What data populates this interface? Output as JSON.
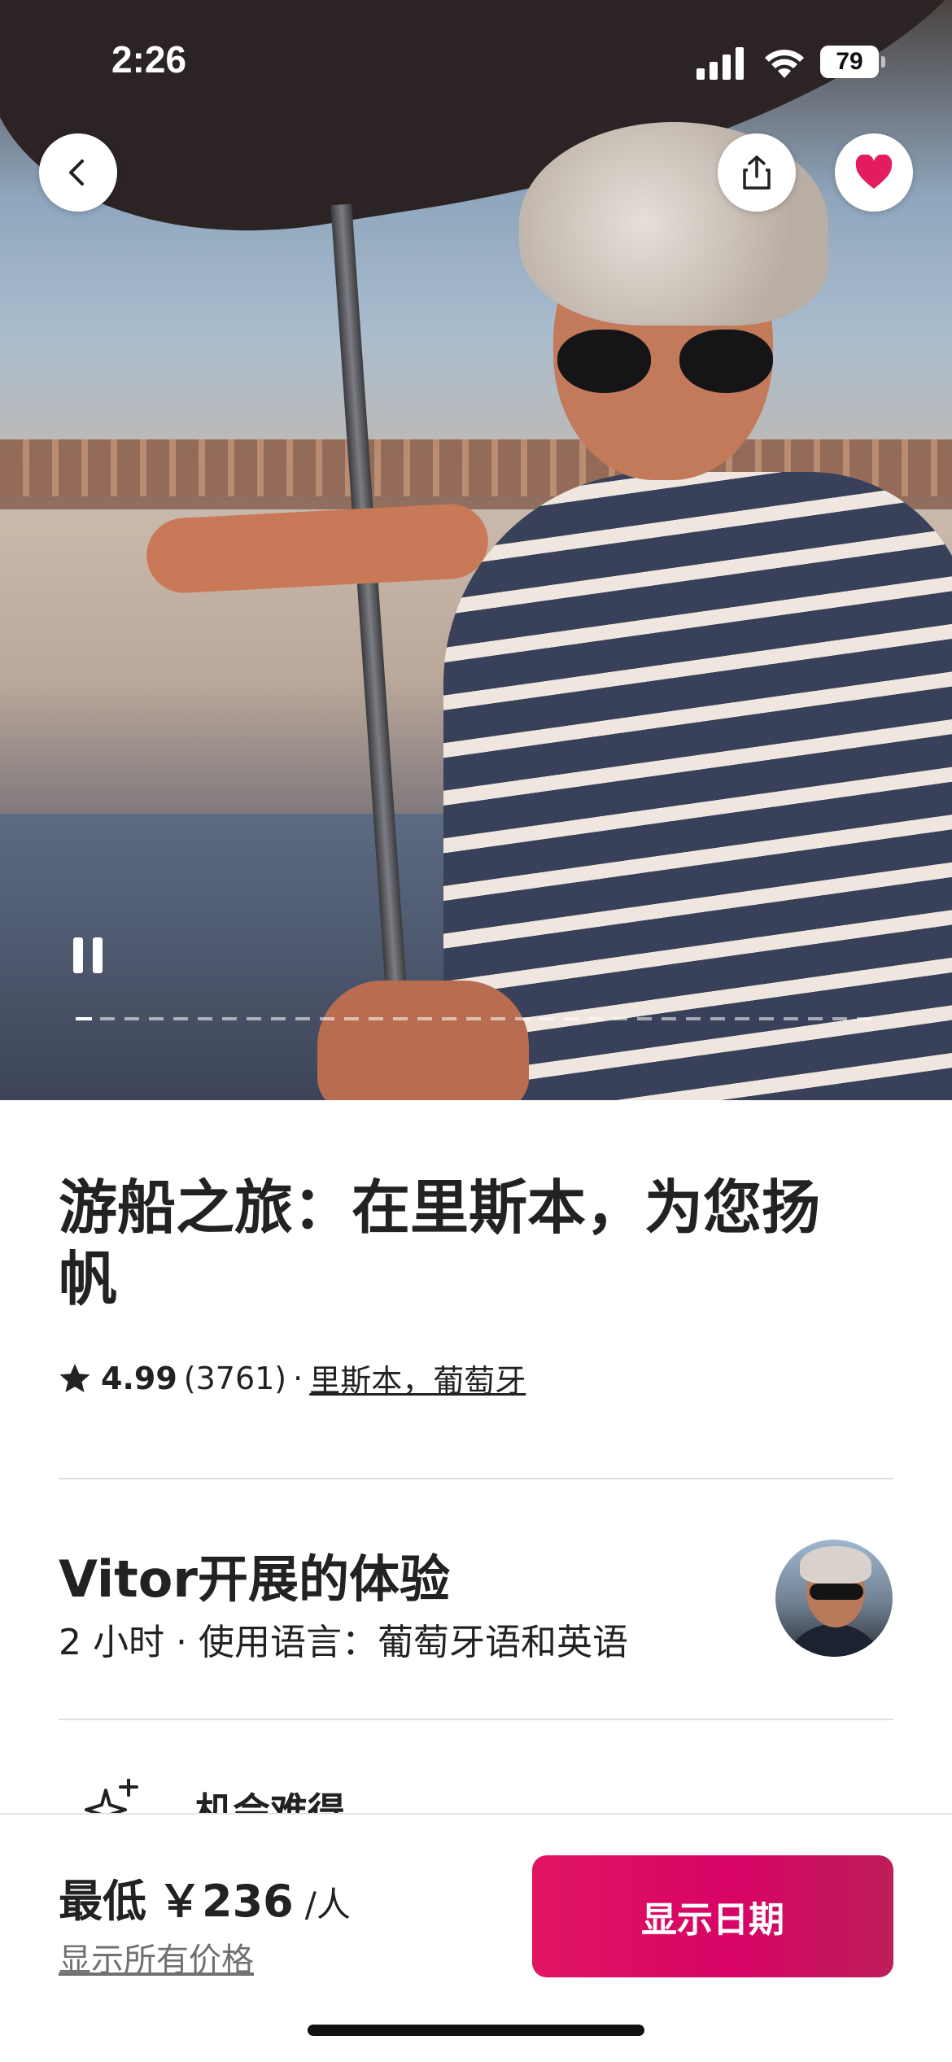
{
  "status_bar": {
    "time": "2:26",
    "battery": "79"
  },
  "hero": {
    "progress_fraction": 0.02,
    "icons": {
      "back": "chevron-left-icon",
      "share": "share-icon",
      "save": "heart-icon",
      "pause": "pause-icon"
    }
  },
  "listing": {
    "title": "游船之旅：在里斯本，为您扬帆",
    "rating": "4.99",
    "review_count": "(3761)",
    "separator": "·",
    "location": "里斯本，葡萄牙"
  },
  "host": {
    "title": "Vitor开展的体验",
    "details": "2 小时 · 使用语言：葡萄牙语和英语"
  },
  "highlight": {
    "label": "机会难得",
    "icon": "sparkle-icon"
  },
  "booking": {
    "price_prefix": "最低",
    "price": "￥236",
    "unit": "/人",
    "all_prices_link": "显示所有价格",
    "cta_label": "显示日期"
  },
  "colors": {
    "accent": "#D70466",
    "heart": "#E31C5F",
    "text": "#222222",
    "muted": "#717171"
  }
}
